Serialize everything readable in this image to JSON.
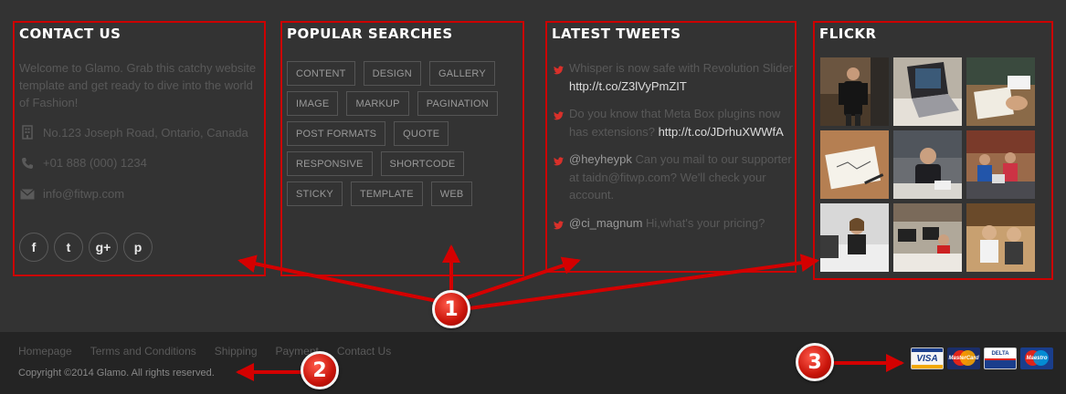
{
  "contact": {
    "title": "CONTACT US",
    "intro": "Welcome to Glamo. Grab this catchy website template and get ready to dive into the world of Fashion!",
    "address": "No.123 Joseph Road, Ontario, Canada",
    "phone": "+01 888 (000) 1234",
    "email": "info@fitwp.com",
    "socials": [
      {
        "name": "facebook-icon",
        "glyph": "f"
      },
      {
        "name": "twitter-icon",
        "glyph": "t"
      },
      {
        "name": "google-plus-icon",
        "glyph": "g+"
      },
      {
        "name": "pinterest-icon",
        "glyph": "p"
      }
    ]
  },
  "popular": {
    "title": "POPULAR SEARCHES",
    "tags": [
      "CONTENT",
      "DESIGN",
      "GALLERY",
      "IMAGE",
      "MARKUP",
      "PAGINATION",
      "POST FORMATS",
      "QUOTE",
      "RESPONSIVE",
      "SHORTCODE",
      "STICKY",
      "TEMPLATE",
      "WEB"
    ]
  },
  "tweets": {
    "title": "LATEST TWEETS",
    "items": [
      {
        "pre_mention": "",
        "mention": "",
        "text": "Whisper is now safe with Revolution Slider ",
        "link": "http://t.co/Z3lVyPmZIT"
      },
      {
        "pre_mention": "",
        "mention": "",
        "text": "Do you know that Meta Box plugins now has extensions? ",
        "link": "http://t.co/JDrhuXWWfA"
      },
      {
        "pre_mention": "",
        "mention": "@heyheypk",
        "text": " Can you mail to our supporter at taidn@fitwp.com? We'll check your account.",
        "link": ""
      },
      {
        "pre_mention": "",
        "mention": "@ci_magnum",
        "text": " Hi,what's your pricing?",
        "link": ""
      }
    ]
  },
  "flickr": {
    "title": "FLICKR"
  },
  "footer": {
    "nav": [
      "Homepage",
      "Terms and Conditions",
      "Shipping",
      "Payment",
      "Contact Us"
    ],
    "copyright": "Copyright ©2014 Glamo. All rights reserved.",
    "cards": [
      {
        "name": "visa-card-icon",
        "label": "VISA"
      },
      {
        "name": "mastercard-card-icon",
        "label": "MasterCard"
      },
      {
        "name": "delta-card-icon",
        "label": "DELTA"
      },
      {
        "name": "maestro-card-icon",
        "label": "Maestro"
      }
    ]
  },
  "annotations": {
    "marker_1": "1",
    "marker_2": "2",
    "marker_3": "3",
    "color": "#d40000"
  }
}
